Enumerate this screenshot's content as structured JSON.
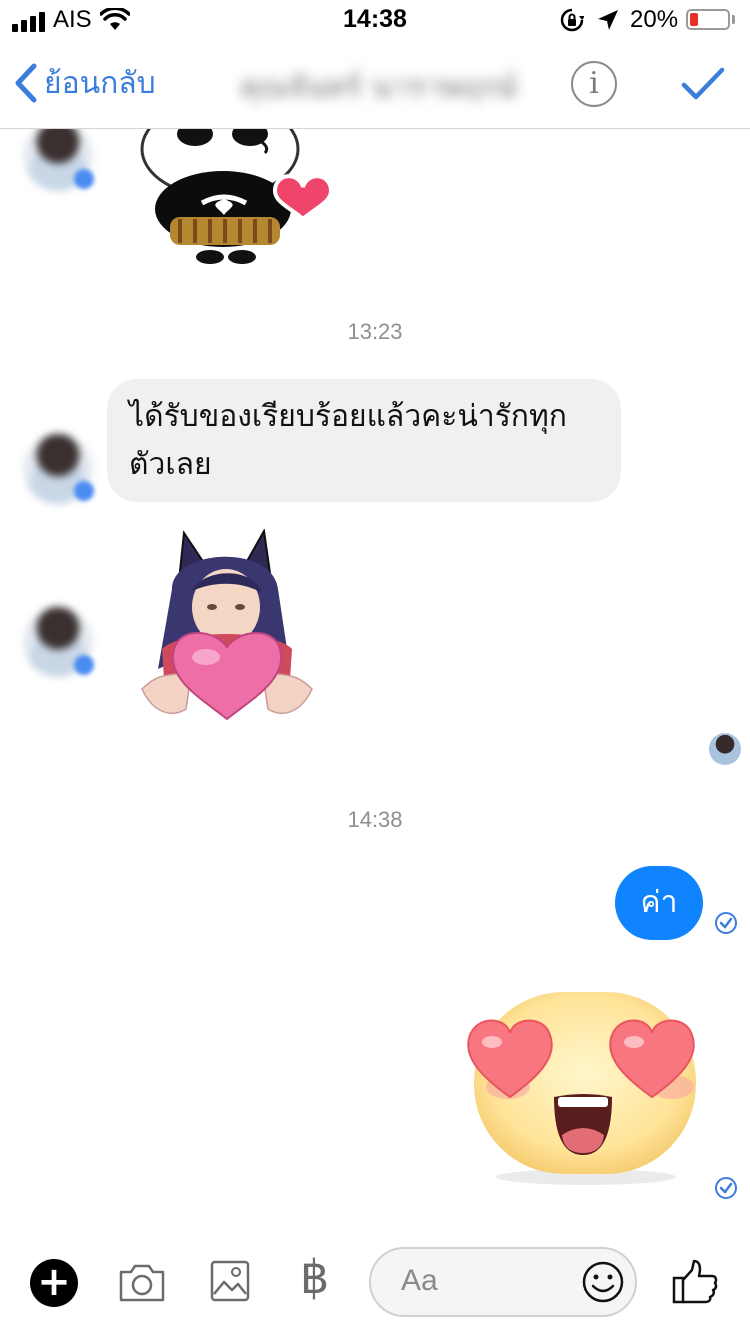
{
  "status_bar": {
    "carrier": "AIS",
    "time": "14:38",
    "battery_percent": "20%"
  },
  "nav": {
    "back_label": "ย้อนกลับ",
    "contact_name": "คุณจันทร์ นาราพฤกษ์",
    "info_label": "i"
  },
  "chat": {
    "timestamp_1": "13:23",
    "incoming_message": "ได้รับของเรียบร้อยแล้วคะน่ารักทุกตัวเลย",
    "timestamp_2": "14:38",
    "outgoing_message": "ค่า"
  },
  "composer": {
    "placeholder": "Aa",
    "baht_symbol": "฿"
  },
  "colors": {
    "accent": "#3b7ddc",
    "outgoing_bubble": "#0f84fe",
    "incoming_bubble": "#f0f0f0"
  },
  "icons": [
    "signal-icon",
    "wifi-icon",
    "rotation-lock-icon",
    "location-arrow-icon",
    "battery-icon",
    "back-chevron-icon",
    "info-icon",
    "checkmark-icon",
    "plus-icon",
    "camera-icon",
    "image-icon",
    "baht-icon",
    "smiley-icon",
    "thumbs-up-icon"
  ]
}
